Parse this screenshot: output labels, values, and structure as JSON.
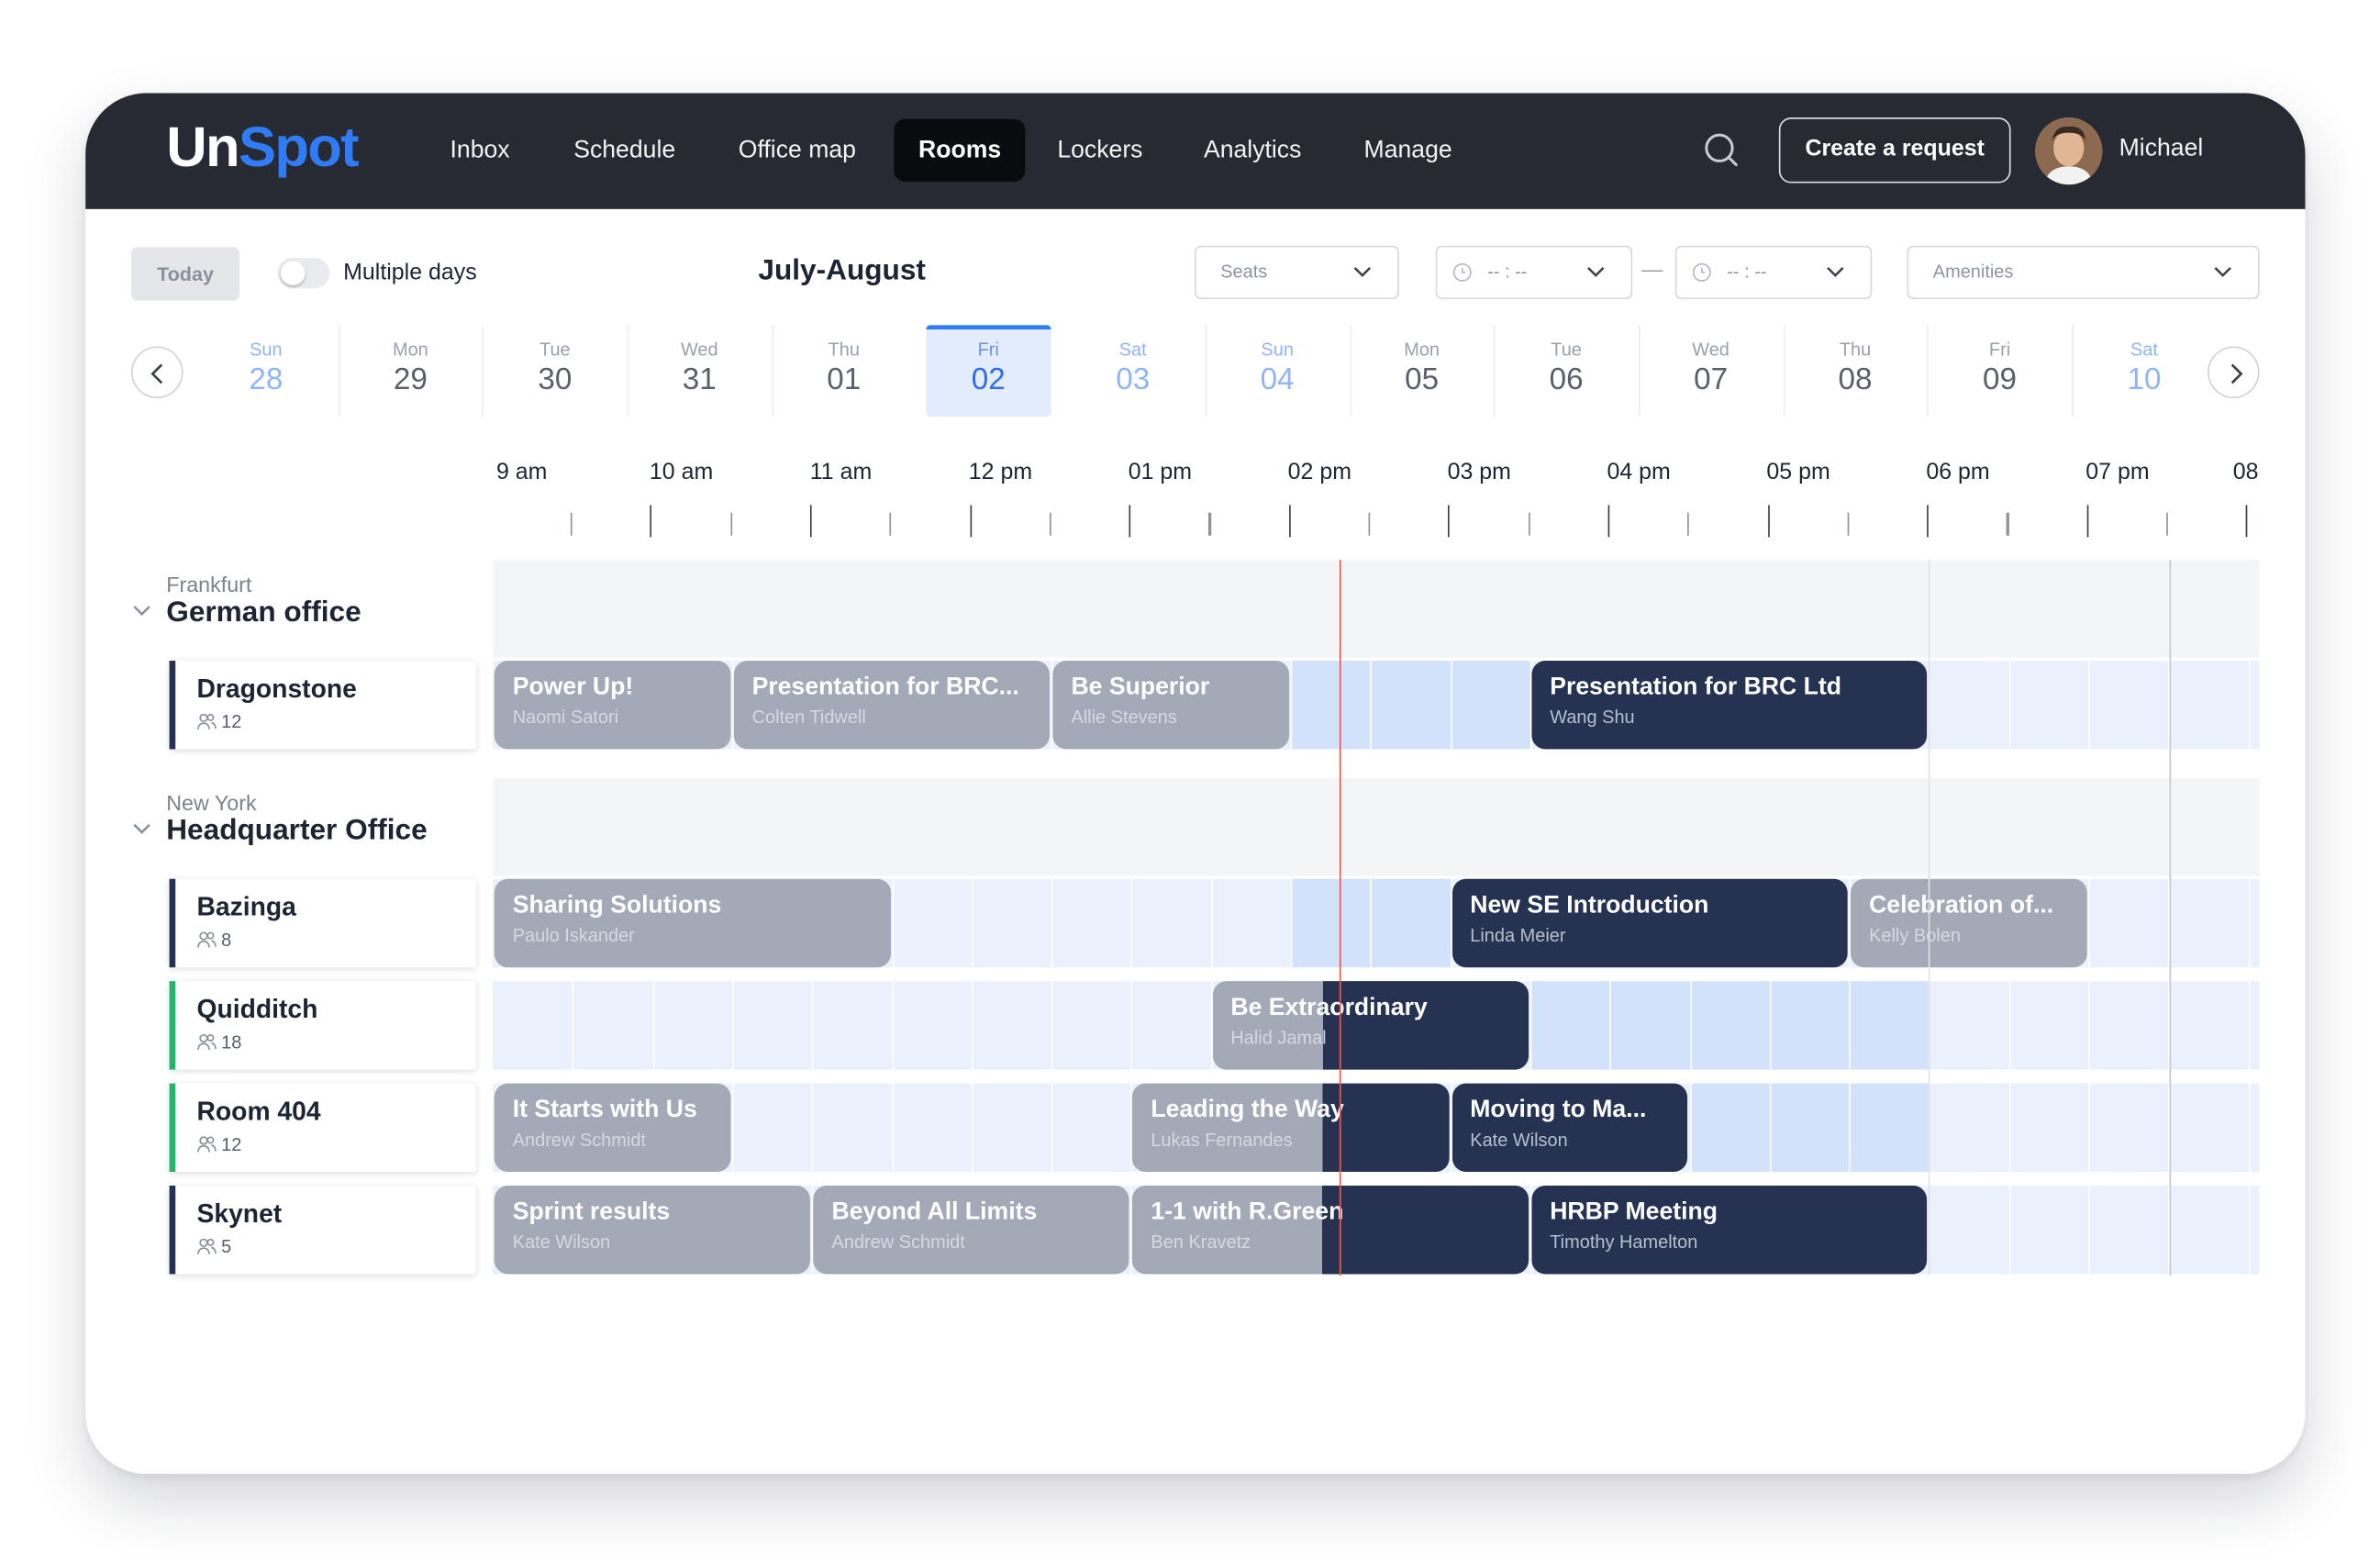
{
  "app": {
    "logo_part1": "Un",
    "logo_part2": "Spot",
    "nav": [
      "Inbox",
      "Schedule",
      "Office map",
      "Rooms",
      "Lockers",
      "Analytics",
      "Manage"
    ],
    "active_nav": "Rooms",
    "create_request_label": "Create a request",
    "user_name": "Michael",
    "accent_color": "#2f7cf6",
    "topbar_color": "#272a33"
  },
  "toolbar": {
    "today_label": "Today",
    "multiple_days_label": "Multiple days",
    "multiple_days_on": false,
    "period_title": "July-August",
    "seats_placeholder": "Seats",
    "time_from_placeholder": "-- : --",
    "time_to_placeholder": "-- : --",
    "range_separator": "—",
    "amenities_placeholder": "Amenities"
  },
  "days": [
    {
      "name": "Sun",
      "num": "28",
      "weekend": true
    },
    {
      "name": "Mon",
      "num": "29",
      "weekend": false
    },
    {
      "name": "Tue",
      "num": "30",
      "weekend": false
    },
    {
      "name": "Wed",
      "num": "31",
      "weekend": false
    },
    {
      "name": "Thu",
      "num": "01",
      "weekend": false
    },
    {
      "name": "Fri",
      "num": "02",
      "weekend": false,
      "selected": true
    },
    {
      "name": "Sat",
      "num": "03",
      "weekend": true
    },
    {
      "name": "Sun",
      "num": "04",
      "weekend": true
    },
    {
      "name": "Mon",
      "num": "05",
      "weekend": false
    },
    {
      "name": "Tue",
      "num": "06",
      "weekend": false
    },
    {
      "name": "Wed",
      "num": "07",
      "weekend": false
    },
    {
      "name": "Thu",
      "num": "08",
      "weekend": false
    },
    {
      "name": "Fri",
      "num": "09",
      "weekend": false
    },
    {
      "name": "Sat",
      "num": "10",
      "weekend": true
    }
  ],
  "hours": [
    "9 am",
    "10 am",
    "11 am",
    "12 pm",
    "01 pm",
    "02 pm",
    "03 pm",
    "04 pm",
    "05 pm",
    "06 pm",
    "07 pm",
    "08"
  ],
  "current_time": "14:12",
  "groups": [
    {
      "city": "Frankfurt",
      "name": "German office",
      "rooms": [
        {
          "name": "Dragonstone",
          "capacity": "12",
          "status_color": "#253252",
          "events": [
            {
              "title": "Power Up!",
              "owner": "Naomi Satori",
              "start": "09:00",
              "end": "10:30",
              "state": "past"
            },
            {
              "title": "Presentation for BRC...",
              "owner": "Colten Tidwell",
              "start": "10:30",
              "end": "12:30",
              "state": "past"
            },
            {
              "title": "Be Superior",
              "owner": "Allie Stevens",
              "start": "12:30",
              "end": "14:00",
              "state": "past"
            },
            {
              "title": "Presentation for BRC Ltd",
              "owner": "Wang Shu",
              "start": "15:30",
              "end": "18:00",
              "state": "future"
            }
          ],
          "highlights": [
            [
              "14:00",
              "15:30"
            ]
          ]
        }
      ]
    },
    {
      "city": "New York",
      "name": "Headquarter Office",
      "rooms": [
        {
          "name": "Bazinga",
          "capacity": "8",
          "status_color": "#253252",
          "events": [
            {
              "title": "Sharing Solutions",
              "owner": "Paulo Iskander",
              "start": "09:00",
              "end": "11:30",
              "state": "past"
            },
            {
              "title": "New SE Introduction",
              "owner": "Linda Meier",
              "start": "15:00",
              "end": "17:30",
              "state": "future"
            },
            {
              "title": "Celebration of...",
              "owner": "Kelly Bolen",
              "start": "17:30",
              "end": "19:00",
              "state": "past"
            }
          ],
          "highlights": [
            [
              "14:00",
              "15:00"
            ]
          ]
        },
        {
          "name": "Quidditch",
          "capacity": "18",
          "status_color": "#27b36b",
          "events": [
            {
              "title": "Be Extraordinary",
              "owner": "Halid Jamal",
              "start": "13:30",
              "end": "15:30",
              "state": "now"
            }
          ],
          "highlights": [
            [
              "15:30",
              "18:00"
            ]
          ]
        },
        {
          "name": "Room 404",
          "capacity": "12",
          "status_color": "#27b36b",
          "events": [
            {
              "title": "It Starts with Us",
              "owner": "Andrew Schmidt",
              "start": "09:00",
              "end": "10:30",
              "state": "past"
            },
            {
              "title": "Leading the Way",
              "owner": "Lukas Fernandes",
              "start": "13:00",
              "end": "15:00",
              "state": "now"
            },
            {
              "title": "Moving to Ma...",
              "owner": "Kate Wilson",
              "start": "15:00",
              "end": "16:30",
              "state": "future"
            }
          ],
          "highlights": [
            [
              "16:30",
              "18:00"
            ]
          ]
        },
        {
          "name": "Skynet",
          "capacity": "5",
          "status_color": "#253252",
          "events": [
            {
              "title": "Sprint results",
              "owner": "Kate Wilson",
              "start": "09:00",
              "end": "11:00",
              "state": "past"
            },
            {
              "title": "Beyond All Limits",
              "owner": "Andrew Schmidt",
              "start": "11:00",
              "end": "13:00",
              "state": "past"
            },
            {
              "title": "1-1 with R.Green",
              "owner": "Ben Kravetz",
              "start": "13:00",
              "end": "15:30",
              "state": "now"
            },
            {
              "title": "HRBP Meeting",
              "owner": "Timothy Hamelton",
              "start": "15:30",
              "end": "18:00",
              "state": "future"
            }
          ],
          "highlights": []
        }
      ]
    }
  ]
}
